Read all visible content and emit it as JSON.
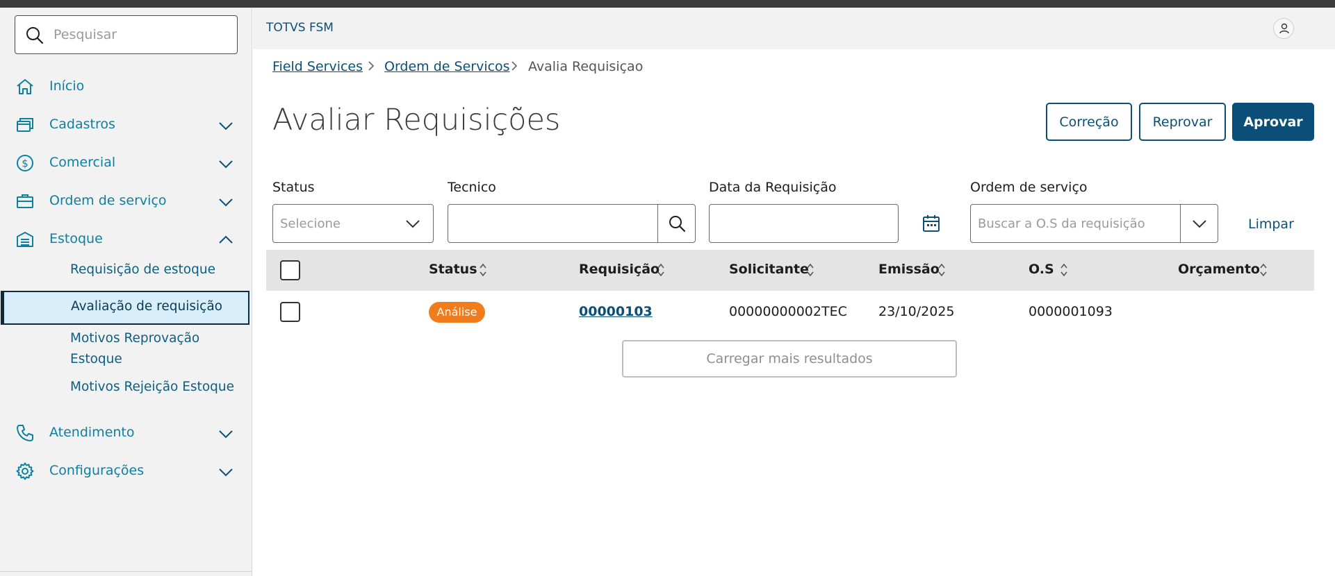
{
  "search": {
    "placeholder": "Pesquisar"
  },
  "sidebar": {
    "items": [
      {
        "label": "Início",
        "icon": "home-icon"
      },
      {
        "label": "Cadastros",
        "icon": "cards-icon"
      },
      {
        "label": "Comercial",
        "icon": "dollar-icon"
      },
      {
        "label": "Ordem de serviço",
        "icon": "briefcase-icon"
      },
      {
        "label": "Estoque",
        "icon": "warehouse-icon",
        "expanded": true
      },
      {
        "label": "Atendimento",
        "icon": "phone-icon"
      },
      {
        "label": "Configurações",
        "icon": "gear-icon"
      }
    ],
    "subitems": [
      {
        "label": "Requisição de estoque"
      },
      {
        "label": "Avaliação de requisição",
        "active": true
      },
      {
        "label": "Motivos Reprovação Estoque"
      },
      {
        "label": "Motivos Rejeição Estoque"
      }
    ]
  },
  "header": {
    "brand": "TOTVS FSM"
  },
  "breadcrumb": [
    "Field Services",
    "Ordem de Servicos",
    "Avalia Requisiçao"
  ],
  "page": {
    "title": "Avaliar Requisições",
    "actions": {
      "correction": "Correção",
      "reject": "Reprovar",
      "approve": "Aprovar"
    }
  },
  "filters": {
    "status": {
      "label": "Status",
      "placeholder": "Selecione"
    },
    "technician": {
      "label": "Tecnico",
      "value": ""
    },
    "date": {
      "label": "Data da Requisição",
      "value": ""
    },
    "order": {
      "label": "Ordem de serviço",
      "placeholder": "Buscar a O.S da requisição"
    },
    "clear": "Limpar"
  },
  "table": {
    "columns": [
      "Status",
      "Requisição",
      "Solicitante",
      "Emissão",
      "O.S",
      "Orçamento"
    ],
    "rows": [
      {
        "status": "Análise",
        "requisition": "00000103",
        "requester": "00000000002TEC",
        "issue_date": "23/10/2025",
        "order": "0000001093",
        "budget": ""
      }
    ],
    "load_more": "Carregar mais resultados"
  },
  "colors": {
    "accent": "#0b4f78",
    "nav_text": "#0c7fa3",
    "badge": "#f07c1b",
    "active_bg": "#d8eefa"
  }
}
